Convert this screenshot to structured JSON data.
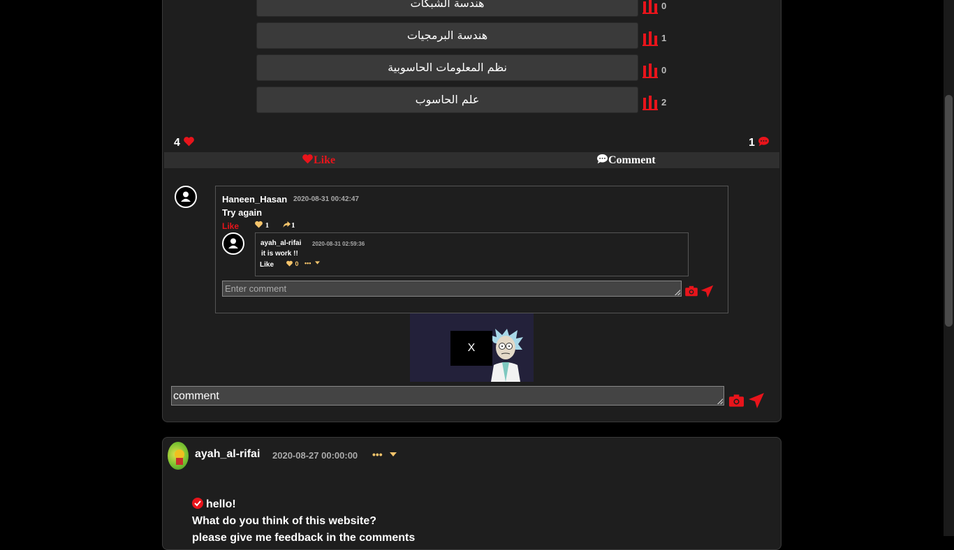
{
  "poll": {
    "options": [
      {
        "label": "هندسة الشبكات",
        "count": "0"
      },
      {
        "label": "هندسة البرمجيات",
        "count": "1"
      },
      {
        "label": "نظم المعلومات الحاسوبية",
        "count": "0"
      },
      {
        "label": "علم الحاسوب",
        "count": "2"
      }
    ]
  },
  "post1": {
    "likes_count": "4",
    "comments_count": "1",
    "like_label": "Like",
    "comment_label": "Comment",
    "comment": {
      "author": "Haneen_Hasan",
      "timestamp": "2020-08-31 00:42:47",
      "text": "Try again",
      "like_label": "Like",
      "hearts": "1",
      "shares": "1",
      "reply": {
        "author": "ayah_al-rifai",
        "timestamp": "2020-08-31 02:59:36",
        "text": "it is work !!",
        "like_label": "Like",
        "hearts": "0",
        "more": "•••"
      },
      "reply_placeholder": "Enter comment"
    },
    "preview_close": "X",
    "comment_input_value": "comment"
  },
  "post2": {
    "author": "ayah_al-rifai",
    "timestamp": "2020-08-27 00:00:00",
    "more": "•••",
    "body_line1": "hello!",
    "body_line2": "What do you think of this website?",
    "body_line3": "please give me feedback in the comments"
  },
  "colors": {
    "accent": "#e8141b",
    "card": "#1e1e1e",
    "heart_gold": "#f5c46b"
  },
  "icons": [
    "poll-icon",
    "heart-icon",
    "comment-icon",
    "user-avatar-icon",
    "camera-icon",
    "send-icon",
    "share-icon",
    "caret-down-icon",
    "check-badge-icon"
  ]
}
